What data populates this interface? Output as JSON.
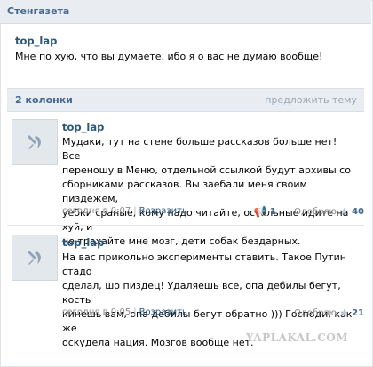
{
  "section": {
    "title": "Стенгазета"
  },
  "status": {
    "author": "top_lap",
    "text": "Мне по хую, что вы думаете, ибо я о вас не думаю вообще!"
  },
  "wall": {
    "count_label": "2 колонки",
    "suggest_label": "предложить тему"
  },
  "posts": [
    {
      "author": "top_lap",
      "lines": [
        "Мудаки, тут на стене больше рассказов больше нет! Все",
        "переношу в Меню, отдельной ссылкой будут архивы со",
        "сборниками рассказов. Вы заебали меня своим пиздежем,",
        "уебки сраные, кому надо читайте, остальные идите на хуй, и",
        "не трахайте мне мозг, дети собак бездарных."
      ],
      "date": "сегодня в 0:07",
      "reply_label": "Возразить",
      "mega_count": "1",
      "approve_label": "Одобряю",
      "approve_count": "40"
    },
    {
      "author": "top_lap",
      "lines": [
        "На вас прикольно эксперименты ставить. Такое Путин стадо",
        "сделал, шо пиздец! Удаляешь все, опа дебилы бегут, кость",
        "кинешь вам, опа дебилы бегут обратно ))) Господи, как же",
        "оскудела нация. Мозгов вообще нет."
      ],
      "date": "сегодня в 0:05",
      "reply_label": "Возразить",
      "approve_label": "Одобряю",
      "approve_count": "21"
    }
  ],
  "watermark": "YAPLAKAL.COM",
  "icons": {
    "avatar": "hammer-sickle-icon",
    "mega": "megaphone-icon",
    "star": "star-icon"
  }
}
